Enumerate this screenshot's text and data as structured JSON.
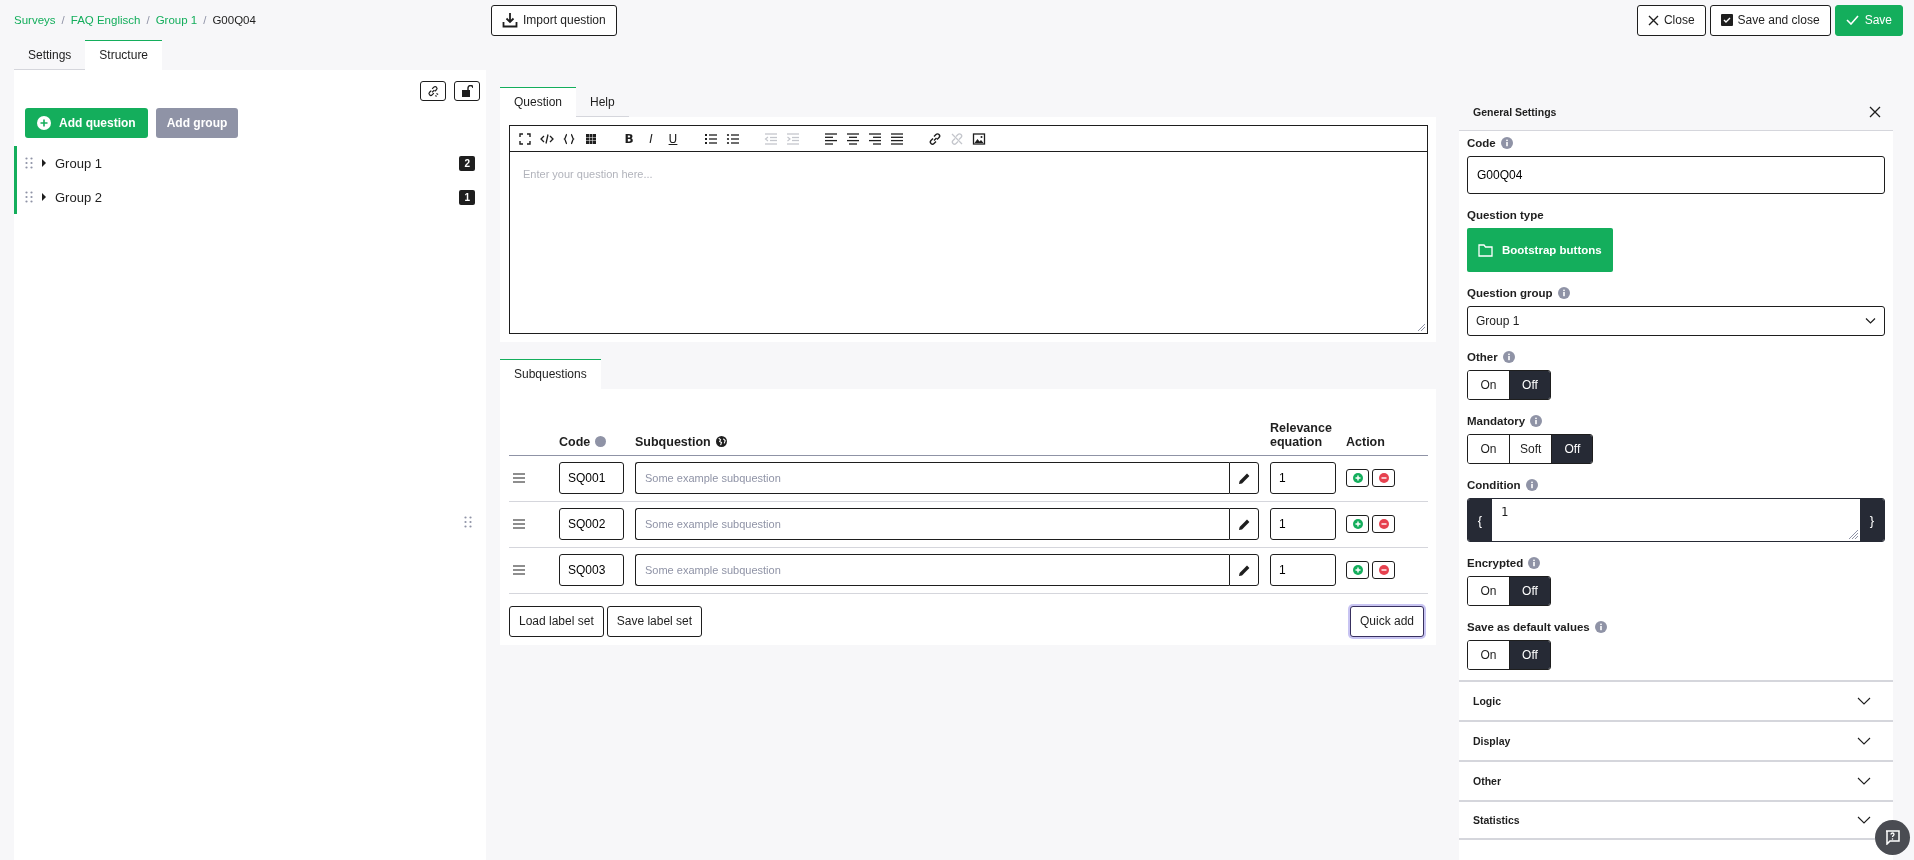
{
  "breadcrumb": [
    {
      "label": "Surveys",
      "kind": "link"
    },
    {
      "separator": "/",
      "label": "FAQ Englisch",
      "kind": "link"
    },
    {
      "separator": "/",
      "label": "Group 1",
      "kind": "link"
    },
    {
      "separator": "/",
      "label": "G00Q04",
      "kind": "current"
    }
  ],
  "import_button": "Import question",
  "actions": [
    {
      "label": "Close",
      "kind": "close"
    },
    {
      "label": "Save and close",
      "kind": "save-close"
    },
    {
      "label": "Save",
      "kind": "save"
    }
  ],
  "sidebar": {
    "tabs": [
      {
        "label": "Settings",
        "selected": false
      },
      {
        "label": "Structure",
        "selected": true
      }
    ],
    "add_question": "Add question",
    "add_group": "Add group",
    "groups": [
      {
        "label": "Group 1",
        "count": "2",
        "expanded": false
      },
      {
        "label": "Group 2",
        "count": "1",
        "expanded": false
      }
    ]
  },
  "editor": {
    "tabs": [
      {
        "label": "Question",
        "selected": true
      },
      {
        "label": "Help",
        "selected": false
      }
    ],
    "toolbar": [
      {
        "kind": "fullscreen",
        "disabled": false
      },
      {
        "kind": "source",
        "disabled": false
      },
      {
        "kind": "braces",
        "disabled": false
      },
      {
        "kind": "grid",
        "disabled": false
      },
      {
        "kind": "bold",
        "label": "B",
        "disabled": false
      },
      {
        "kind": "italic",
        "label": "I",
        "disabled": false
      },
      {
        "kind": "underline",
        "label": "U",
        "disabled": false
      },
      {
        "kind": "ol",
        "disabled": false
      },
      {
        "kind": "ul",
        "disabled": false
      },
      {
        "kind": "outdent",
        "disabled": true
      },
      {
        "kind": "indent",
        "disabled": true
      },
      {
        "kind": "align-left",
        "disabled": false
      },
      {
        "kind": "align-center",
        "disabled": false
      },
      {
        "kind": "align-right",
        "disabled": false
      },
      {
        "kind": "justify",
        "disabled": false
      },
      {
        "kind": "link",
        "disabled": false
      },
      {
        "kind": "unlink",
        "disabled": true
      },
      {
        "kind": "image",
        "disabled": false
      }
    ],
    "placeholder": "Enter your question here..."
  },
  "subquestions": {
    "tab": "Subquestions",
    "columns": [
      "Code",
      "Subquestion",
      "Relevance equation",
      "Action"
    ],
    "rows": [
      {
        "code": "SQ001",
        "placeholder": "Some example subquestion",
        "relevance": "1"
      },
      {
        "code": "SQ002",
        "placeholder": "Some example subquestion",
        "relevance": "1"
      },
      {
        "code": "SQ003",
        "placeholder": "Some example subquestion",
        "relevance": "1"
      }
    ],
    "buttons": [
      "Load label set",
      "Save label set"
    ],
    "quick_add": {
      "label": "Quick add",
      "focused": true
    }
  },
  "settings": {
    "title": "General Settings",
    "fields": [
      {
        "kind": "text",
        "label": "Code",
        "info": true,
        "value": "G00Q04"
      },
      {
        "kind": "type",
        "label": "Question type",
        "value": "Bootstrap buttons"
      },
      {
        "kind": "select",
        "label": "Question group",
        "info": true,
        "value": "Group 1"
      },
      {
        "kind": "toggle",
        "label": "Other",
        "info": true,
        "options": [
          {
            "label": "On",
            "selected": false
          },
          {
            "label": "Off",
            "selected": true
          }
        ]
      },
      {
        "kind": "toggle",
        "label": "Mandatory",
        "info": true,
        "options": [
          {
            "label": "On",
            "selected": false
          },
          {
            "label": "Soft",
            "selected": false
          },
          {
            "label": "Off",
            "selected": true
          }
        ]
      },
      {
        "kind": "condition",
        "label": "Condition",
        "info": true,
        "value": "1",
        "open": "{",
        "close": "}"
      },
      {
        "kind": "toggle",
        "label": "Encrypted",
        "info": true,
        "options": [
          {
            "label": "On",
            "selected": false
          },
          {
            "label": "Off",
            "selected": true
          }
        ]
      },
      {
        "kind": "toggle",
        "label": "Save as default values",
        "info": true,
        "options": [
          {
            "label": "On",
            "selected": false
          },
          {
            "label": "Off",
            "selected": true
          }
        ]
      }
    ],
    "sections": [
      {
        "label": "Logic",
        "expanded": false
      },
      {
        "label": "Display",
        "expanded": false
      },
      {
        "label": "Other",
        "expanded": false
      },
      {
        "label": "Statistics",
        "expanded": false
      }
    ]
  }
}
